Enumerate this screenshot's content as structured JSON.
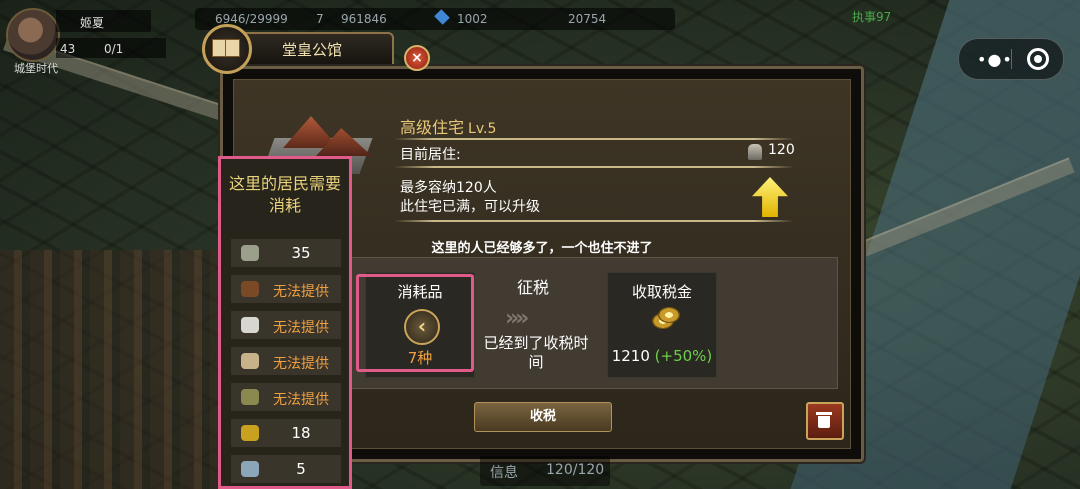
{
  "hud": {
    "player_name": "姬夏",
    "player_level": "43",
    "progress": "0/1",
    "era": "城堡时代",
    "grain": "6946/29999",
    "num_small": "7",
    "gold": "961846",
    "gems": "1002",
    "stone": "20754",
    "label_right": "执事97"
  },
  "dialog": {
    "title": "堂皇公馆",
    "building_name": "高级住宅",
    "building_level": "Lv.5",
    "occupancy_label": "目前居住:",
    "occupancy_value": "120",
    "desc_line1": "最多容纳120人",
    "desc_line2": "此住宅已满，可以升级",
    "notice": "这里的人已经够多了，一个也住不进了",
    "consumables_title": "消耗品",
    "consumables_icon": "chevron-left-icon",
    "consumables_count": "7种",
    "tax_title": "征税",
    "tax_arrows": "››››",
    "tax_status": "已经到了收税时间",
    "income_title": "收取税金",
    "income_value": "1210",
    "income_bonus": "(+50%)",
    "collect_button": "收税"
  },
  "consumption": {
    "title": "这里的居民需要消耗",
    "items": [
      {
        "icon": "fish-icon",
        "value": "35",
        "color": "#9aa08a"
      },
      {
        "icon": "barrel-icon",
        "value": "无法提供",
        "color": "#7a4a26"
      },
      {
        "icon": "salt-icon",
        "value": "无法提供",
        "color": "#d8d6d0"
      },
      {
        "icon": "bread-icon",
        "value": "无法提供",
        "color": "#c8b28a"
      },
      {
        "icon": "bucket-icon",
        "value": "无法提供",
        "color": "#8a8a50"
      },
      {
        "icon": "lamp-oil-icon",
        "value": "18",
        "color": "#c9a020"
      },
      {
        "icon": "cloth-icon",
        "value": "5",
        "color": "#8aa6b8"
      }
    ]
  },
  "bottom": {
    "info": "信息",
    "capacity": "120/120"
  },
  "colors": {
    "highlight": "#e05a8a",
    "gold_text": "#e8c878",
    "orange_text": "#f0a040",
    "green_text": "#6ecf4a"
  }
}
